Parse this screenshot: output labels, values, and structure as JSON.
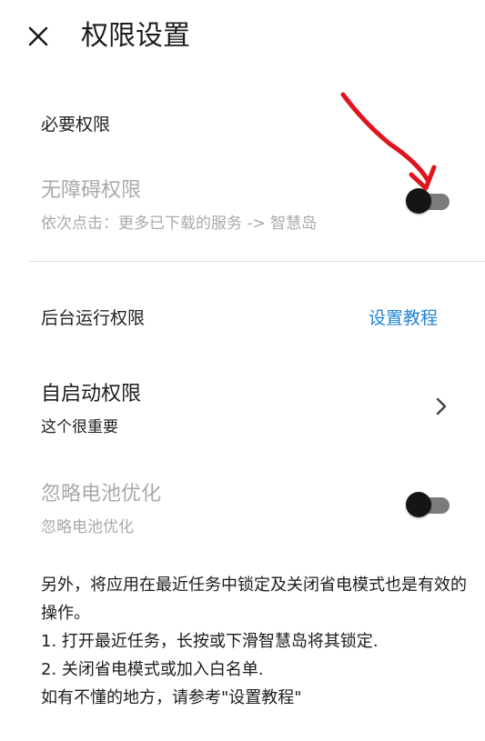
{
  "header": {
    "close_icon": "close-icon",
    "title": "权限设置"
  },
  "sections": {
    "required": {
      "label": "必要权限",
      "accessibility": {
        "title": "无障碍权限",
        "subtitle": "依次点击：更多已下载的服务 -> 智慧岛",
        "enabled": false
      }
    },
    "background": {
      "label": "后台运行权限",
      "tutorial_link": "设置教程",
      "autostart": {
        "title": "自启动权限",
        "subtitle": "这个很重要",
        "chevron_icon": "chevron-right-icon"
      },
      "battery": {
        "title": "忽略电池优化",
        "subtitle": "忽略电池优化",
        "enabled": false
      }
    }
  },
  "note": {
    "line1": "另外，将应用在最近任务中锁定及关闭省电模式也是有效的操作。",
    "line2": "1. 打开最近任务，长按或下滑智慧岛将其锁定.",
    "line3": "2. 关闭省电模式或加入白名单.",
    "line4": "如有不懂的地方，请参考\"设置教程\""
  },
  "colors": {
    "accent_link": "#1f84d6",
    "disabled_text": "#a9a9a9",
    "annotation_arrow": "#e0141c"
  }
}
